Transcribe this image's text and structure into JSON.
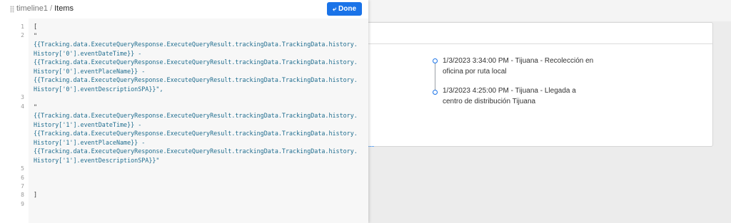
{
  "editor": {
    "breadcrumb": {
      "component": "timeline1",
      "separator": "/",
      "field": "Items"
    },
    "done_label": "Done",
    "done_icon": "arrow-icon",
    "line_numbers": [
      "1",
      "2",
      "3",
      "4",
      "5",
      "6",
      "7",
      "8",
      "9"
    ],
    "code": {
      "l1": "[",
      "l2a": "\"",
      "l2b": "{{Tracking.data.ExecuteQueryResponse.ExecuteQueryResult.trackingData.TrackingData.history.",
      "l2c": "History['0'].eventDateTime}} -",
      "l2d": "{{Tracking.data.ExecuteQueryResponse.ExecuteQueryResult.trackingData.TrackingData.history.",
      "l2e": "History['0'].eventPlaceName}} -",
      "l2f": "{{Tracking.data.ExecuteQueryResponse.ExecuteQueryResult.trackingData.TrackingData.history.",
      "l2g": "History['0'].eventDescriptionSPA}}\",",
      "l4a": "\"",
      "l4b": "{{Tracking.data.ExecuteQueryResponse.ExecuteQueryResult.trackingData.TrackingData.history.",
      "l4c": "History['1'].eventDateTime}} -",
      "l4d": "{{Tracking.data.ExecuteQueryResponse.ExecuteQueryResult.trackingData.TrackingData.history.",
      "l4e": "History['1'].eventPlaceName}} -",
      "l4f": "{{Tracking.data.ExecuteQueryResponse.ExecuteQueryResult.trackingData.TrackingData.history.",
      "l4g": "History['1'].eventDescriptionSPA}}\"",
      "l8": "]"
    }
  },
  "timeline": {
    "items": [
      {
        "text": "1/3/2023 3:34:00 PM - Tijuana - Recolección en oficina por ruta local"
      },
      {
        "text": "1/3/2023 4:25:00 PM - Tijuana - Llegada a centro de distribución Tijuana"
      }
    ]
  },
  "colors": {
    "accent": "#1a73e8",
    "code_bind": "#1f6d8f",
    "brace": "#2e8b57"
  }
}
